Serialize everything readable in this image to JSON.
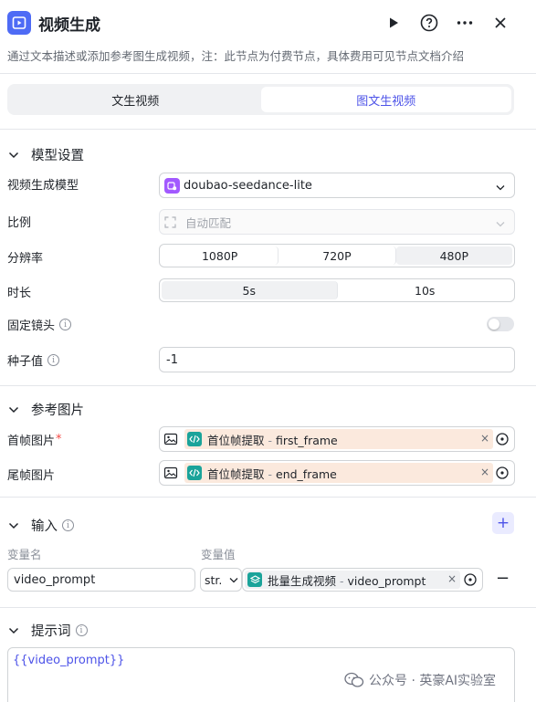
{
  "header": {
    "title": "视频生成",
    "description": "通过文本描述或添加参考图生成视频，注：此节点为付费节点，具体费用可见节点文档介绍"
  },
  "tabs": [
    {
      "label": "文生视频",
      "active": false
    },
    {
      "label": "图文生视频",
      "active": true
    }
  ],
  "model_settings": {
    "section_title": "模型设置",
    "model": {
      "label": "视频生成模型",
      "value": "doubao-seedance-lite"
    },
    "ratio": {
      "label": "比例",
      "value": "自动匹配"
    },
    "resolution": {
      "label": "分辨率",
      "options": [
        "1080P",
        "720P",
        "480P"
      ],
      "selected": "480P"
    },
    "duration": {
      "label": "时长",
      "options": [
        "5s",
        "10s"
      ],
      "selected": "5s"
    },
    "fixed_camera": {
      "label": "固定镜头",
      "enabled": false
    },
    "seed": {
      "label": "种子值",
      "value": "-1"
    }
  },
  "reference_images": {
    "section_title": "参考图片",
    "first_frame": {
      "label": "首帧图片",
      "required_mark": "*",
      "node": "首位帧提取",
      "separator": "-",
      "field": "first_frame"
    },
    "last_frame": {
      "label": "尾帧图片",
      "node": "首位帧提取",
      "separator": "-",
      "field": "end_frame"
    }
  },
  "input": {
    "section_title": "输入",
    "col_name": "变量名",
    "col_value": "变量值",
    "rows": [
      {
        "name": "video_prompt",
        "type": "str.",
        "node": "批量生成视频",
        "separator": "-",
        "field": "video_prompt"
      }
    ]
  },
  "prompt": {
    "section_title": "提示词",
    "value": "{{video_prompt}}"
  },
  "watermark": {
    "text": "公众号 · 英豪AI实验室"
  },
  "colors": {
    "accent": "#4d53e8",
    "app_icon": "#4e6bf5",
    "model_icon": "#a259ff",
    "node_teal": "#1aa39a",
    "ref_tag_bg": "#fbe9dd"
  }
}
